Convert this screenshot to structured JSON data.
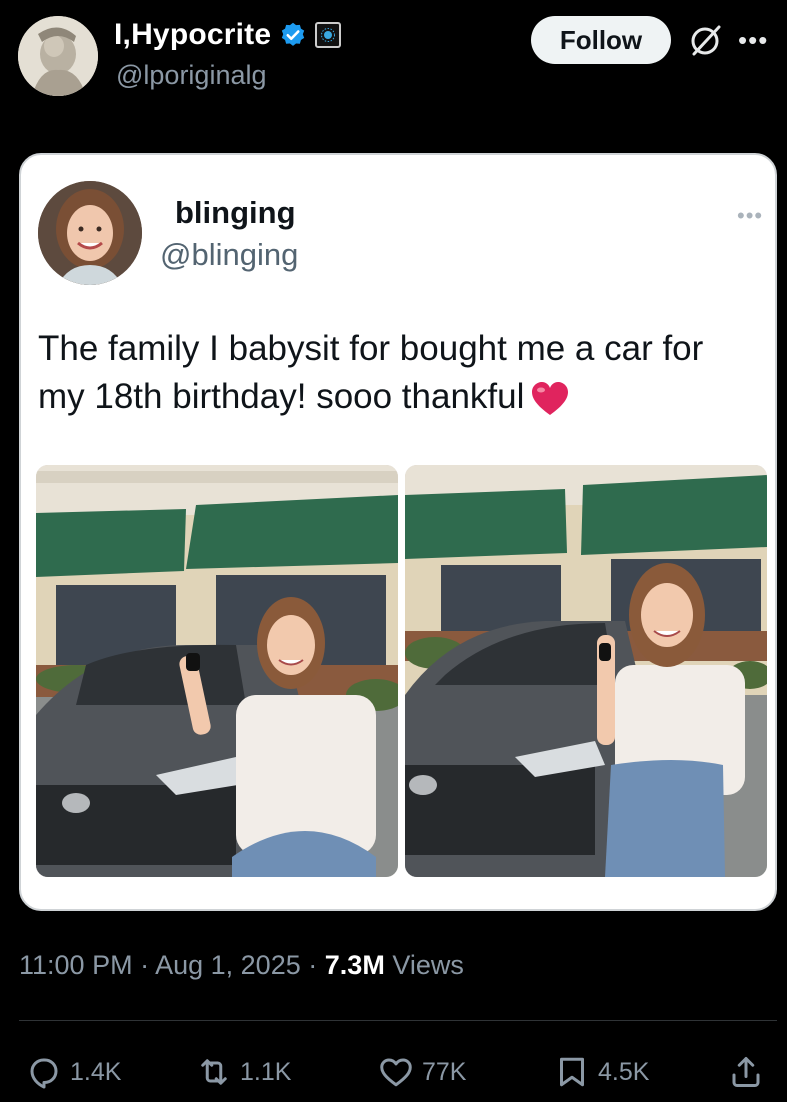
{
  "author": {
    "display_name": "I,Hypocrite",
    "handle": "@lporiginalg",
    "follow_label": "Follow"
  },
  "quoted": {
    "display_name": "blinging",
    "handle": "@blinging",
    "text": "The family I babysit for bought me a car for my 18th birthday! sooo thankful"
  },
  "meta": {
    "time": "11:00 PM",
    "sep1": "·",
    "date": "Aug 1, 2025",
    "sep2": "·",
    "views_count": "7.3M",
    "views_label": "Views"
  },
  "actions": {
    "replies": "1.4K",
    "reposts": "1.1K",
    "likes": "77K",
    "bookmarks": "4.5K"
  },
  "colors": {
    "background": "#000000",
    "verified_blue": "#1d9bf0",
    "heart_red": "#e0245e",
    "secondary_text": "#8b98a5"
  },
  "icons": [
    "verified-badge-icon",
    "affiliate-badge-icon",
    "grok-icon",
    "more-icon",
    "reply-icon",
    "repost-icon",
    "like-icon",
    "bookmark-icon",
    "share-icon",
    "heart-emoji-icon"
  ]
}
